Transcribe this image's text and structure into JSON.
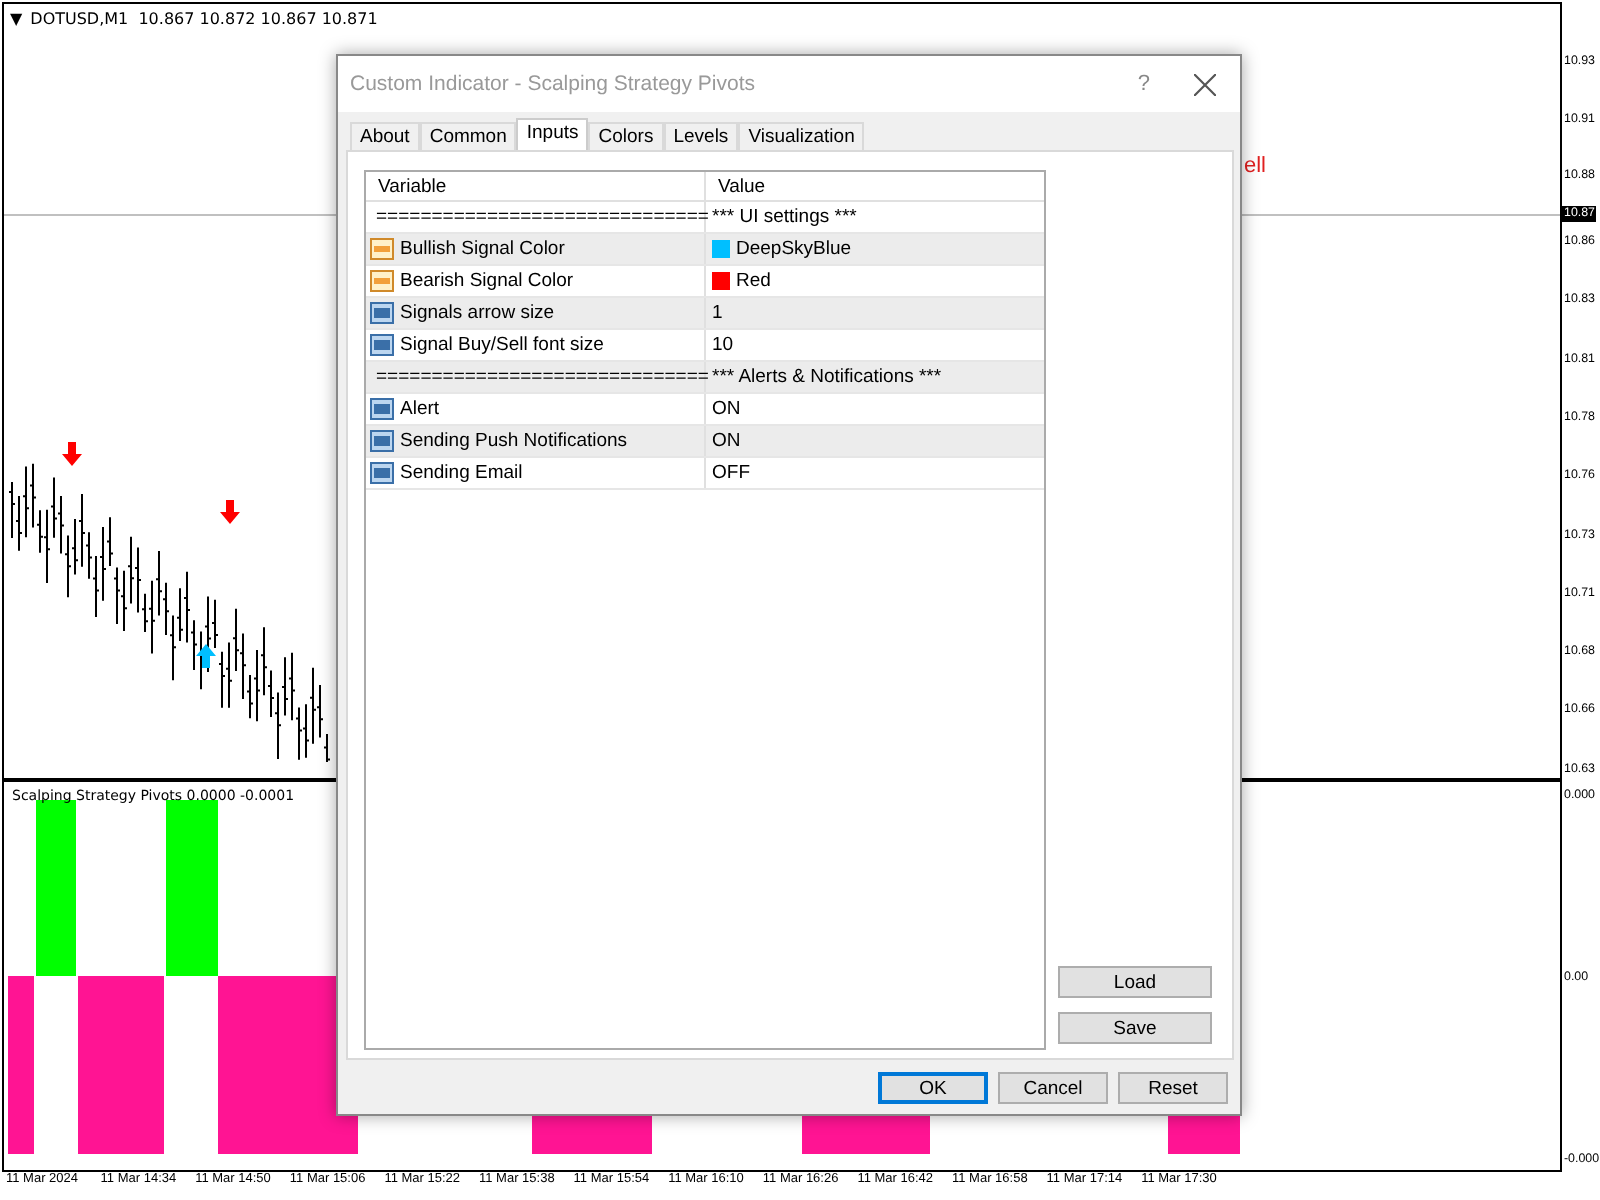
{
  "chart": {
    "symbol_marker": "▼",
    "symbol": "DOTUSD,M1",
    "quotes": "10.867 10.872 10.867 10.871",
    "signal_text": "ell",
    "price_scale": [
      "10.93",
      "10.91",
      "10.88",
      "10.86",
      "10.83",
      "10.81",
      "10.78",
      "10.76",
      "10.73",
      "10.71",
      "10.68",
      "10.66",
      "10.63"
    ],
    "current_price": "10.87",
    "indicator_label": "Scalping Strategy Pivots 0.0000 -0.0001",
    "indicator_scale": [
      "0.000",
      "0.00",
      "-0.000"
    ],
    "time_axis": [
      "11 Mar 2024",
      "11 Mar 14:34",
      "11 Mar 14:50",
      "11 Mar 15:06",
      "11 Mar 15:22",
      "11 Mar 15:38",
      "11 Mar 15:54",
      "11 Mar 16:10",
      "11 Mar 16:26",
      "11 Mar 16:42",
      "11 Mar 16:58",
      "11 Mar 17:14",
      "11 Mar 17:30"
    ]
  },
  "dialog": {
    "title": "Custom Indicator - Scalping Strategy Pivots",
    "help": "?",
    "tabs": [
      {
        "label": "About",
        "selected": false
      },
      {
        "label": "Common",
        "selected": false
      },
      {
        "label": "Inputs",
        "selected": true
      },
      {
        "label": "Colors",
        "selected": false
      },
      {
        "label": "Levels",
        "selected": false
      },
      {
        "label": "Visualization",
        "selected": false
      }
    ],
    "table": {
      "columns": [
        "Variable",
        "Value"
      ],
      "rows": [
        {
          "kind": "string",
          "variable": "==============================",
          "value": "*** UI settings ***"
        },
        {
          "kind": "color",
          "variable": "Bullish Signal Color",
          "value": "DeepSkyBlue",
          "color": "#00bfff"
        },
        {
          "kind": "color",
          "variable": "Bearish Signal Color",
          "value": "Red",
          "color": "#ff0000"
        },
        {
          "kind": "int",
          "variable": "Signals arrow size",
          "value": "1"
        },
        {
          "kind": "int",
          "variable": "Signal Buy/Sell font size",
          "value": "10"
        },
        {
          "kind": "string",
          "variable": "==============================",
          "value": "*** Alerts & Notifications  ***"
        },
        {
          "kind": "int",
          "variable": "Alert",
          "value": "ON"
        },
        {
          "kind": "int",
          "variable": "Sending Push Notifications",
          "value": "ON"
        },
        {
          "kind": "int",
          "variable": "Sending Email",
          "value": "OFF"
        }
      ]
    },
    "side_buttons": [
      "Load",
      "Save"
    ],
    "buttons": [
      {
        "label": "OK",
        "selected": true
      },
      {
        "label": "Cancel",
        "selected": false
      },
      {
        "label": "Reset",
        "selected": false
      }
    ]
  }
}
